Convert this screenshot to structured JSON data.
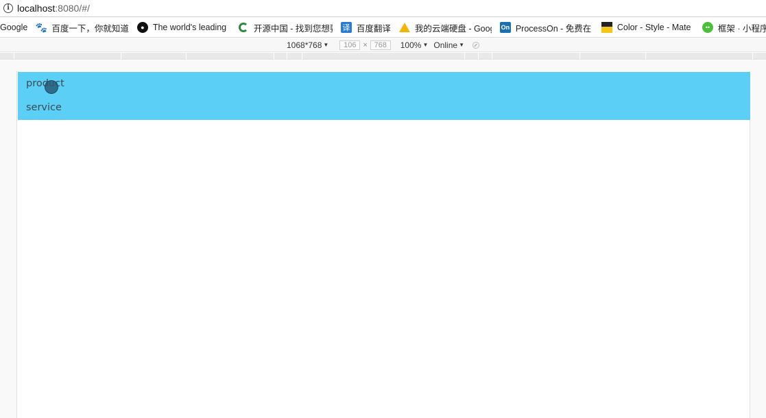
{
  "address_bar": {
    "url_host": "localhost",
    "url_rest": ":8080/#/"
  },
  "bookmarks": [
    {
      "label": "Google",
      "icon": "none"
    },
    {
      "label": "百度一下，你就知道",
      "icon": "baidu-paw-icon"
    },
    {
      "label": "The world's leading",
      "icon": "github-icon"
    },
    {
      "label": "开源中国 - 找到您想要",
      "icon": "oschina-icon"
    },
    {
      "label": "百度翻译",
      "icon": "translate-icon",
      "glyph": "译"
    },
    {
      "label": "我的云端硬盘 - Goog",
      "icon": "google-drive-icon"
    },
    {
      "label": "ProcessOn - 免费在",
      "icon": "processon-icon",
      "glyph": "On"
    },
    {
      "label": "Color - Style - Mate",
      "icon": "material-icon"
    },
    {
      "label": "框架 · 小程序",
      "icon": "wechat-icon"
    }
  ],
  "device_toolbar": {
    "preset": "1068*768",
    "width_value": "106",
    "height_value": "768",
    "times": "×",
    "zoom": "100%",
    "network": "Online"
  },
  "menu": {
    "items": [
      {
        "label": "product"
      },
      {
        "label": "service"
      }
    ]
  },
  "colors": {
    "menu_background": "#5bcff5",
    "menu_text": "#3b4a55",
    "stage_background": "#f9f9f9"
  }
}
